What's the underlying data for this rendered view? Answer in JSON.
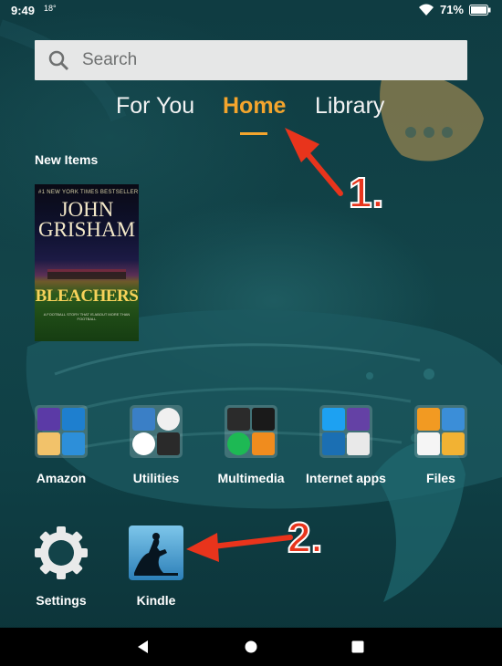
{
  "status": {
    "time": "9:49",
    "temp": "18°",
    "battery": "71%"
  },
  "search": {
    "placeholder": "Search"
  },
  "tabs": [
    {
      "label": "For You"
    },
    {
      "label": "Home"
    },
    {
      "label": "Library"
    }
  ],
  "new_items": {
    "title": "New Items",
    "book": {
      "banner": "#1 NEW YORK TIMES BESTSELLER",
      "author_line1": "JOHN",
      "author_line2": "GRISHAM",
      "title": "BLEACHERS",
      "blurb": "A FOOTBALL STORY THAT IS ABOUT MORE THAN FOOTBALL"
    }
  },
  "apps": [
    {
      "label": "Amazon"
    },
    {
      "label": "Utilities"
    },
    {
      "label": "Multimedia"
    },
    {
      "label": "Internet apps"
    },
    {
      "label": "Files"
    },
    {
      "label": "Settings"
    },
    {
      "label": "Kindle"
    }
  ],
  "annotations": {
    "step1": "1.",
    "step2": "2."
  },
  "colors": {
    "accent": "#f4a52d",
    "arrow": "#e8341c"
  }
}
